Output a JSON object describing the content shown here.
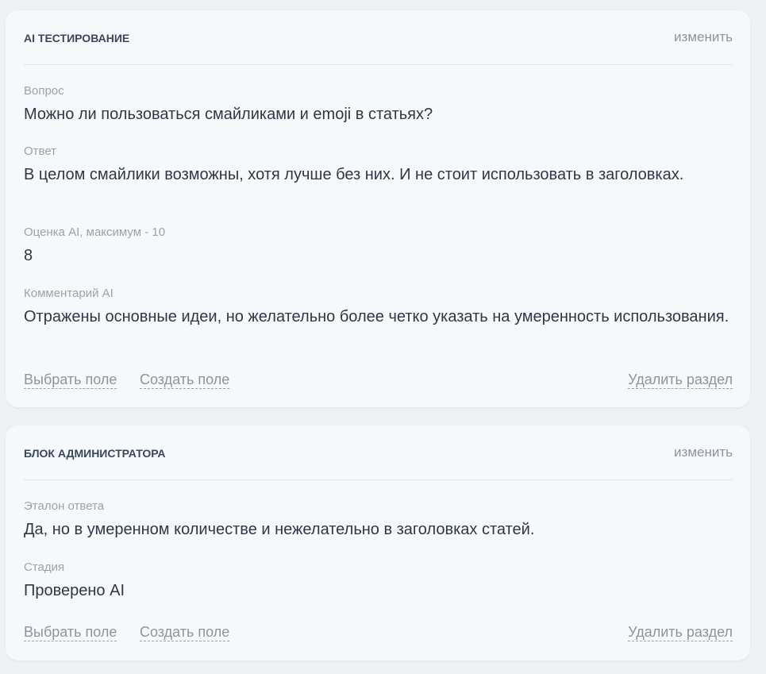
{
  "ai_section": {
    "title": "AI ТЕСТИРОВАНИЕ",
    "edit_label": "изменить",
    "fields": [
      {
        "label": "Вопрос",
        "value": "Можно ли пользоваться смайликами и emoji в статьях?"
      },
      {
        "label": "Ответ",
        "value": "В целом смайлики возможны, хотя лучше без них. И не стоит использовать в заголовках."
      },
      {
        "label": "Оценка AI, максимум - 10",
        "value": "8"
      },
      {
        "label": "Комментарий AI",
        "value": "Отражены основные идеи, но желательно более четко указать на умеренность использования."
      }
    ],
    "select_field_label": "Выбрать поле",
    "create_field_label": "Создать поле",
    "delete_section_label": "Удалить раздел"
  },
  "admin_section": {
    "title": "БЛОК АДМИНИСТРАТОРА",
    "edit_label": "изменить",
    "fields": [
      {
        "label": "Эталон ответа",
        "value": "Да, но в умеренном количестве и нежелательно в заголовках статей."
      },
      {
        "label": "Стадия",
        "value": "Проверено AI"
      }
    ],
    "select_field_label": "Выбрать поле",
    "create_field_label": "Создать поле",
    "delete_section_label": "Удалить раздел"
  }
}
